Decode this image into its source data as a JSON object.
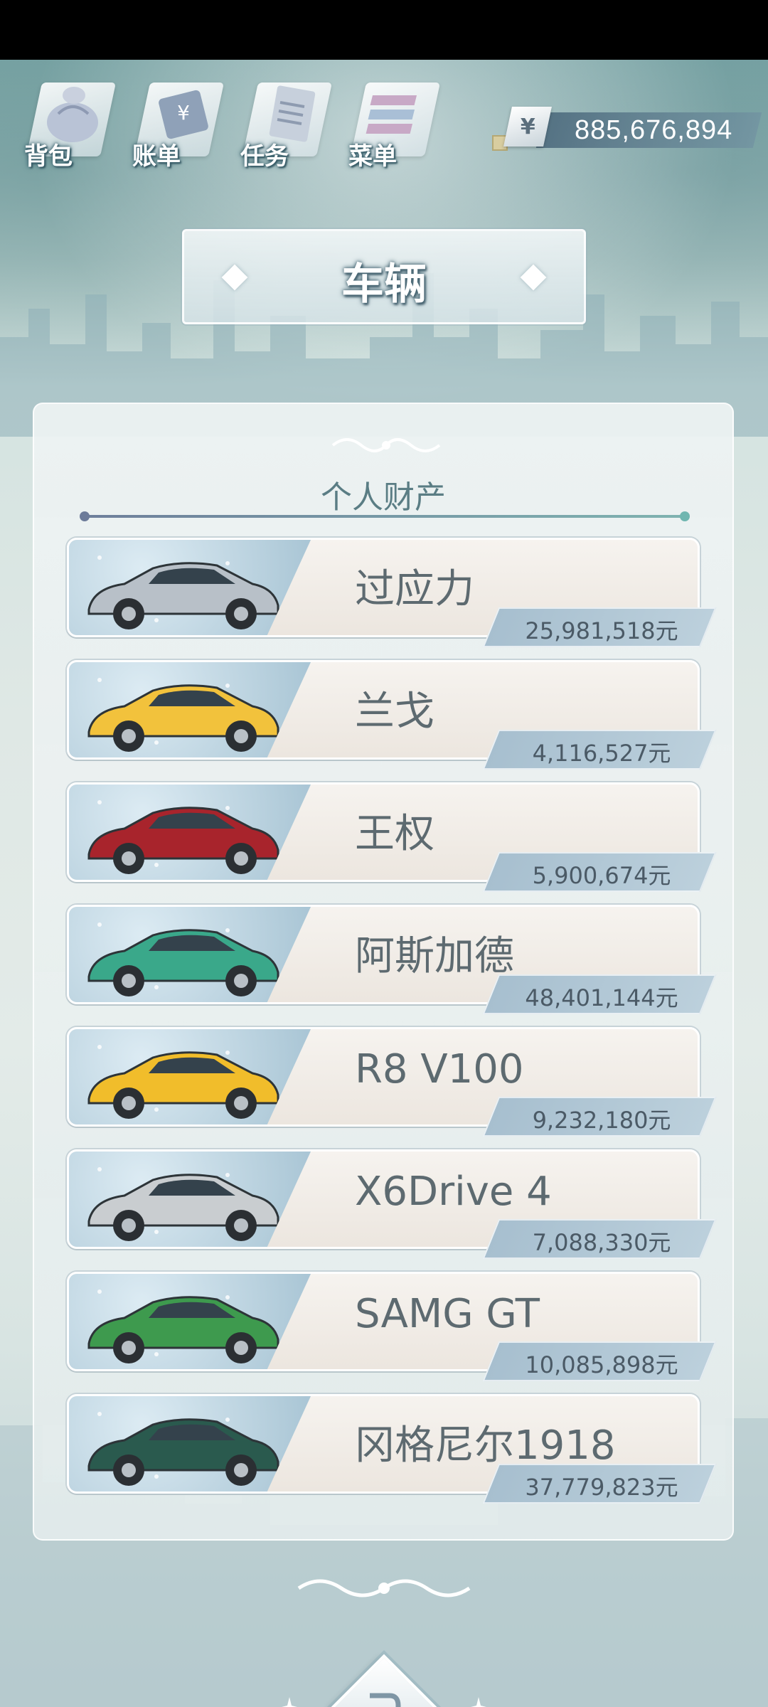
{
  "menu": {
    "items": [
      {
        "label": "背包",
        "icon": "backpack-icon"
      },
      {
        "label": "账单",
        "icon": "bill-icon"
      },
      {
        "label": "任务",
        "icon": "task-icon"
      },
      {
        "label": "菜单",
        "icon": "menu-icon"
      }
    ]
  },
  "currency": {
    "symbol": "¥",
    "value": "885,676,894"
  },
  "header": {
    "title": "车辆"
  },
  "panel": {
    "section_title": "个人财产",
    "cars": [
      {
        "name": "过应力",
        "price": "25,981,518元",
        "color": "#b8c0c8"
      },
      {
        "name": "兰戈",
        "price": "4,116,527元",
        "color": "#f2c23c"
      },
      {
        "name": "王权",
        "price": "5,900,674元",
        "color": "#a8242c"
      },
      {
        "name": "阿斯加德",
        "price": "48,401,144元",
        "color": "#3aa88a"
      },
      {
        "name": "R8 V100",
        "price": "9,232,180元",
        "color": "#f1bd2b"
      },
      {
        "name": "X6Drive 4",
        "price": "7,088,330元",
        "color": "#c9cdd0"
      },
      {
        "name": "SAMG GT",
        "price": "10,085,898元",
        "color": "#3e9a4e"
      },
      {
        "name": "冈格尼尔1918",
        "price": "37,779,823元",
        "color": "#2a5a4e"
      }
    ]
  }
}
